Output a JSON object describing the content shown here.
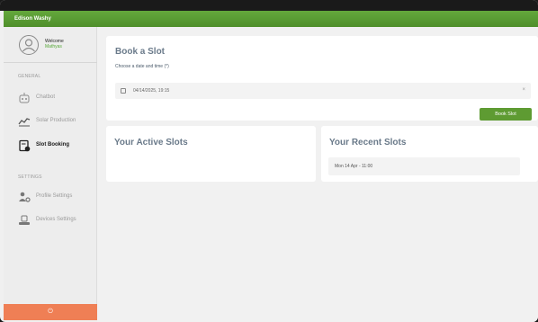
{
  "app": {
    "title": "Edison Washy"
  },
  "user": {
    "welcome": "Welcome",
    "name": "Mathyas"
  },
  "sidebar": {
    "general_label": "GENERAL",
    "settings_label": "SETTINGS",
    "items": [
      {
        "label": "Chatbot",
        "icon": "chatbot-icon"
      },
      {
        "label": "Solar Production",
        "icon": "chart-line-icon"
      },
      {
        "label": "Slot Booking",
        "icon": "booking-icon",
        "active": true
      },
      {
        "label": "Profile Settings",
        "icon": "profile-settings-icon"
      },
      {
        "label": "Devices Settings",
        "icon": "devices-icon"
      }
    ],
    "logout_icon": "power-icon",
    "logout_glyph": "⏻"
  },
  "book": {
    "title": "Book a Slot",
    "label": "Choose a date and time (*)",
    "date_value": "04/14/2025, 19:15",
    "clear_glyph": "×",
    "button": "Book Slot"
  },
  "active_slots": {
    "title": "Your Active Slots"
  },
  "recent_slots": {
    "title": "Your Recent Slots",
    "items": [
      "Mon 14 Apr - 11:00"
    ]
  },
  "colors": {
    "accent": "#5e9b32",
    "logout": "#ef7f55"
  }
}
